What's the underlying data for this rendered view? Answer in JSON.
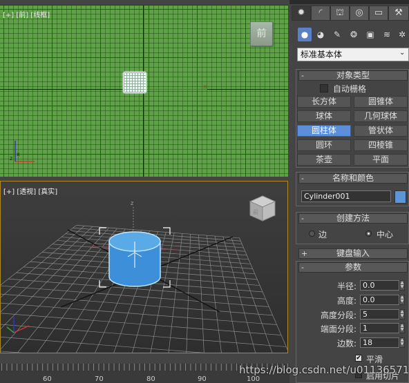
{
  "viewports": {
    "front": {
      "label": "[+] [前] [线框]",
      "viewcube_label": "前",
      "axis_x_tag": "x"
    },
    "perspective": {
      "label": "[+] [透视] [真实]",
      "viewcube_label": "前",
      "axis_z_tag": "z"
    }
  },
  "timeline": {
    "ticks": [
      "60",
      "70",
      "80",
      "90",
      "100"
    ]
  },
  "command_panel": {
    "tabs": [
      {
        "icon": "create-icon",
        "glyph": "✹"
      },
      {
        "icon": "modify-icon",
        "glyph": "◜"
      },
      {
        "icon": "hierarchy-icon",
        "glyph": "⛫"
      },
      {
        "icon": "motion-icon",
        "glyph": "◎"
      },
      {
        "icon": "display-icon",
        "glyph": "▭"
      },
      {
        "icon": "utilities-icon",
        "glyph": "⚒"
      }
    ],
    "subtabs": [
      {
        "icon": "geometry-icon",
        "glyph": "●"
      },
      {
        "icon": "shapes-icon",
        "glyph": "◕"
      },
      {
        "icon": "lights-icon",
        "glyph": "✎"
      },
      {
        "icon": "cameras-icon",
        "glyph": "❂"
      },
      {
        "icon": "helpers-icon",
        "glyph": "▣"
      },
      {
        "icon": "spacewarps-icon",
        "glyph": "≋"
      },
      {
        "icon": "systems-icon",
        "glyph": "✲"
      }
    ],
    "category": "标准基本体",
    "object_type": {
      "title": "对象类型",
      "autogrid_label": "自动栅格",
      "buttons": [
        "长方体",
        "圆锥体",
        "球体",
        "几何球体",
        "圆柱体",
        "管状体",
        "圆环",
        "四棱锥",
        "茶壶",
        "平面"
      ],
      "selected": "圆柱体"
    },
    "name_color": {
      "title": "名称和颜色",
      "name_value": "Cylinder001",
      "color": "#5b96d6"
    },
    "creation_method": {
      "title": "创建方法",
      "options": [
        "边",
        "中心"
      ],
      "selected": "中心"
    },
    "keyboard_entry": {
      "title": "键盘输入"
    },
    "parameters": {
      "title": "参数",
      "rows": [
        {
          "label": "半径:",
          "value": "0.0"
        },
        {
          "label": "高度:",
          "value": "0.0"
        },
        {
          "label": "高度分段:",
          "value": "5"
        },
        {
          "label": "端面分段:",
          "value": "1"
        },
        {
          "label": "边数:",
          "value": "18"
        }
      ],
      "smooth_label": "平滑",
      "smooth_checked": true,
      "slice_label": "启用切片"
    }
  },
  "watermark": "https://blog.csdn.net/u011365716"
}
